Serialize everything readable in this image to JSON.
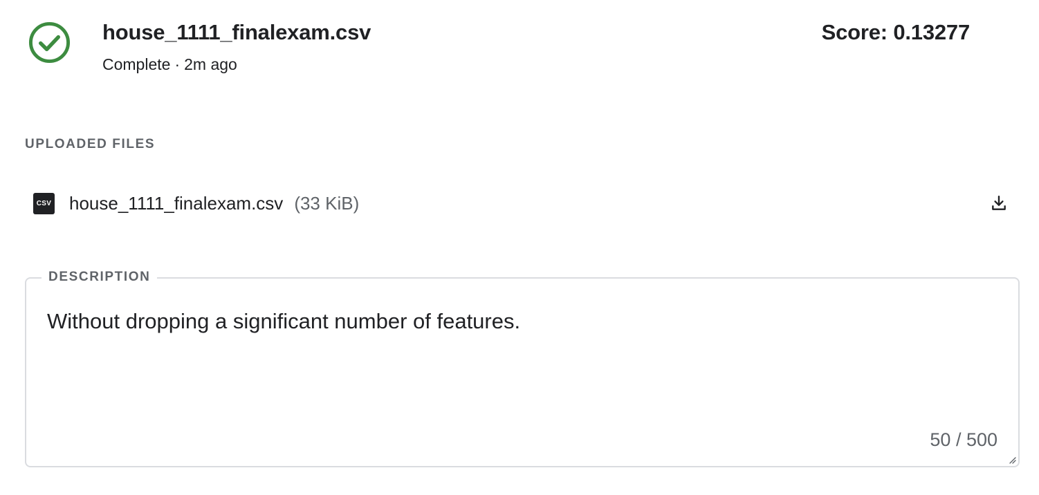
{
  "submission": {
    "file_name": "house_1111_finalexam.csv",
    "status": "Complete",
    "separator": "·",
    "time_ago": "2m ago",
    "score_label": "Score: 0.13277",
    "status_icon": "check-circle-icon",
    "status_color": "#3d8c40"
  },
  "uploaded_files": {
    "label": "UPLOADED FILES",
    "files": [
      {
        "icon": "csv-file-icon",
        "icon_text": "CSV",
        "name": "house_1111_finalexam.csv",
        "size": "(33 KiB)",
        "action_icon": "download-icon"
      }
    ]
  },
  "description": {
    "label": "DESCRIPTION",
    "value": "Without dropping a significant number of features.",
    "counter": "50 / 500"
  }
}
